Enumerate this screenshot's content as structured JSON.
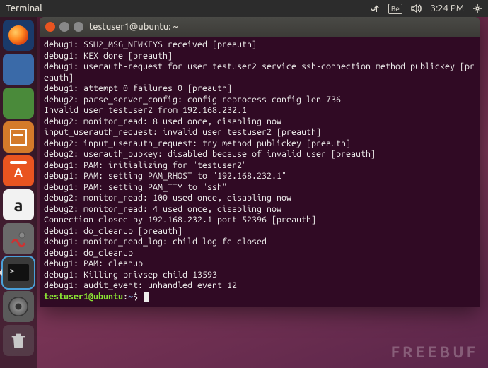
{
  "topbar": {
    "title": "Terminal",
    "time": "3:24 PM",
    "be_label": "Be"
  },
  "window": {
    "title": "testuser1@ubuntu: ~"
  },
  "terminal": {
    "lines": [
      "debug1: SSH2_MSG_NEWKEYS received [preauth]",
      "debug1: KEX done [preauth]",
      "debug1: userauth-request for user testuser2 service ssh-connection method publickey [preauth]",
      "debug1: attempt 0 failures 0 [preauth]",
      "debug2: parse_server_config: config reprocess config len 736",
      "Invalid user testuser2 from 192.168.232.1",
      "debug2: monitor_read: 8 used once, disabling now",
      "input_userauth_request: invalid user testuser2 [preauth]",
      "debug2: input_userauth_request: try method publickey [preauth]",
      "debug2: userauth_pubkey: disabled because of invalid user [preauth]",
      "debug1: PAM: initializing for \"testuser2\"",
      "debug1: PAM: setting PAM_RHOST to \"192.168.232.1\"",
      "debug1: PAM: setting PAM_TTY to \"ssh\"",
      "debug2: monitor_read: 100 used once, disabling now",
      "debug2: monitor_read: 4 used once, disabling now",
      "Connection closed by 192.168.232.1 port 52396 [preauth]",
      "debug1: do_cleanup [preauth]",
      "debug1: monitor_read_log: child log fd closed",
      "debug1: do_cleanup",
      "debug1: PAM: cleanup",
      "debug1: Killing privsep child 13593",
      "debug1: audit_event: unhandled event 12"
    ],
    "prompt_user": "testuser1@ubuntu",
    "prompt_sep": ":",
    "prompt_path": "~",
    "prompt_symbol": "$"
  },
  "watermark": "FREEBUF"
}
